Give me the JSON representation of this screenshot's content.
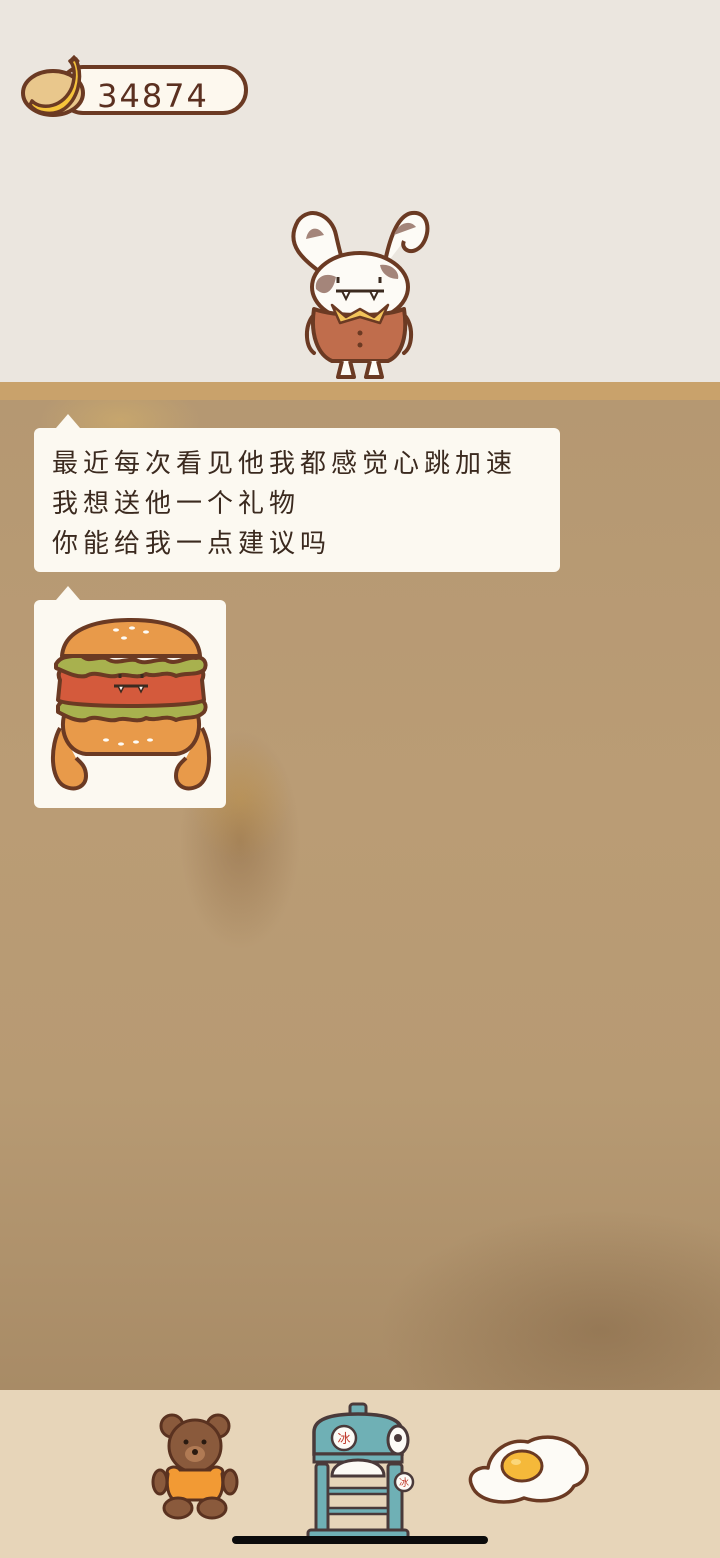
{
  "hud": {
    "currency_icon": "banana-icon",
    "currency_value": "34874"
  },
  "character": {
    "icon": "bunny-monster-character"
  },
  "dialog": {
    "lines": [
      "最近每次看见他我都感觉心跳加速",
      "我想送他一个礼物",
      "你能给我一点建议吗"
    ],
    "image_icon": "burger-monster-icon"
  },
  "bottom_bar": {
    "items": [
      {
        "icon": "teddy-bear-icon"
      },
      {
        "icon": "shaved-ice-machine-icon",
        "label": "冰"
      },
      {
        "icon": "fried-egg-icon"
      }
    ]
  },
  "colors": {
    "outline": "#6b3a23",
    "board": "#b89b74",
    "shelf": "#c9a26b",
    "bubble": "#fcf9f1",
    "bottom_bar": "#e7d5b9"
  }
}
